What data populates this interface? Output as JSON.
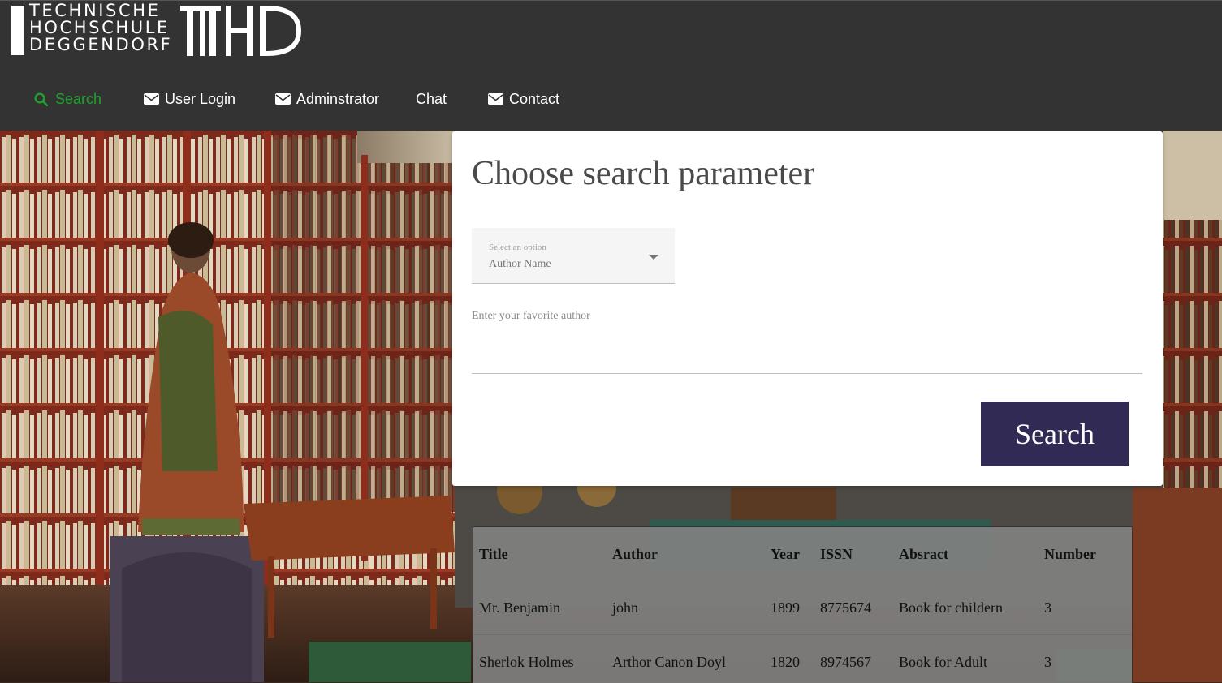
{
  "logo": {
    "line1": "TECHNISCHE",
    "line2": "HOCHSCHULE",
    "line3": "DEGGENDORF",
    "mark": "THD"
  },
  "nav": {
    "items": [
      {
        "label": "Search",
        "icon": "search-icon",
        "active": true
      },
      {
        "label": "User Login",
        "icon": "envelope-icon"
      },
      {
        "label": "Adminstrator",
        "icon": "envelope-icon"
      },
      {
        "label": "Chat"
      },
      {
        "label": "Contact",
        "icon": "envelope-icon"
      }
    ]
  },
  "search": {
    "title": "Choose search parameter",
    "select_label": "Select an option",
    "select_value": "Author Name",
    "input_label": "Enter your favorite author",
    "input_value": "",
    "button_label": "Search"
  },
  "results": {
    "columns": [
      "Title",
      "Author",
      "Year",
      "ISSN",
      "Absract",
      "Number"
    ],
    "rows": [
      [
        "Mr. Benjamin",
        "john",
        "1899",
        "8775674",
        "Book for childern",
        "3"
      ],
      [
        "Sherlok Holmes",
        "Arthor Canon Doyl",
        "1820",
        "8974567",
        "Book for Adult",
        "3"
      ]
    ]
  },
  "colors": {
    "header_bg": "#333333",
    "nav_active": "#1fa12e",
    "button_bg": "#302a54"
  }
}
